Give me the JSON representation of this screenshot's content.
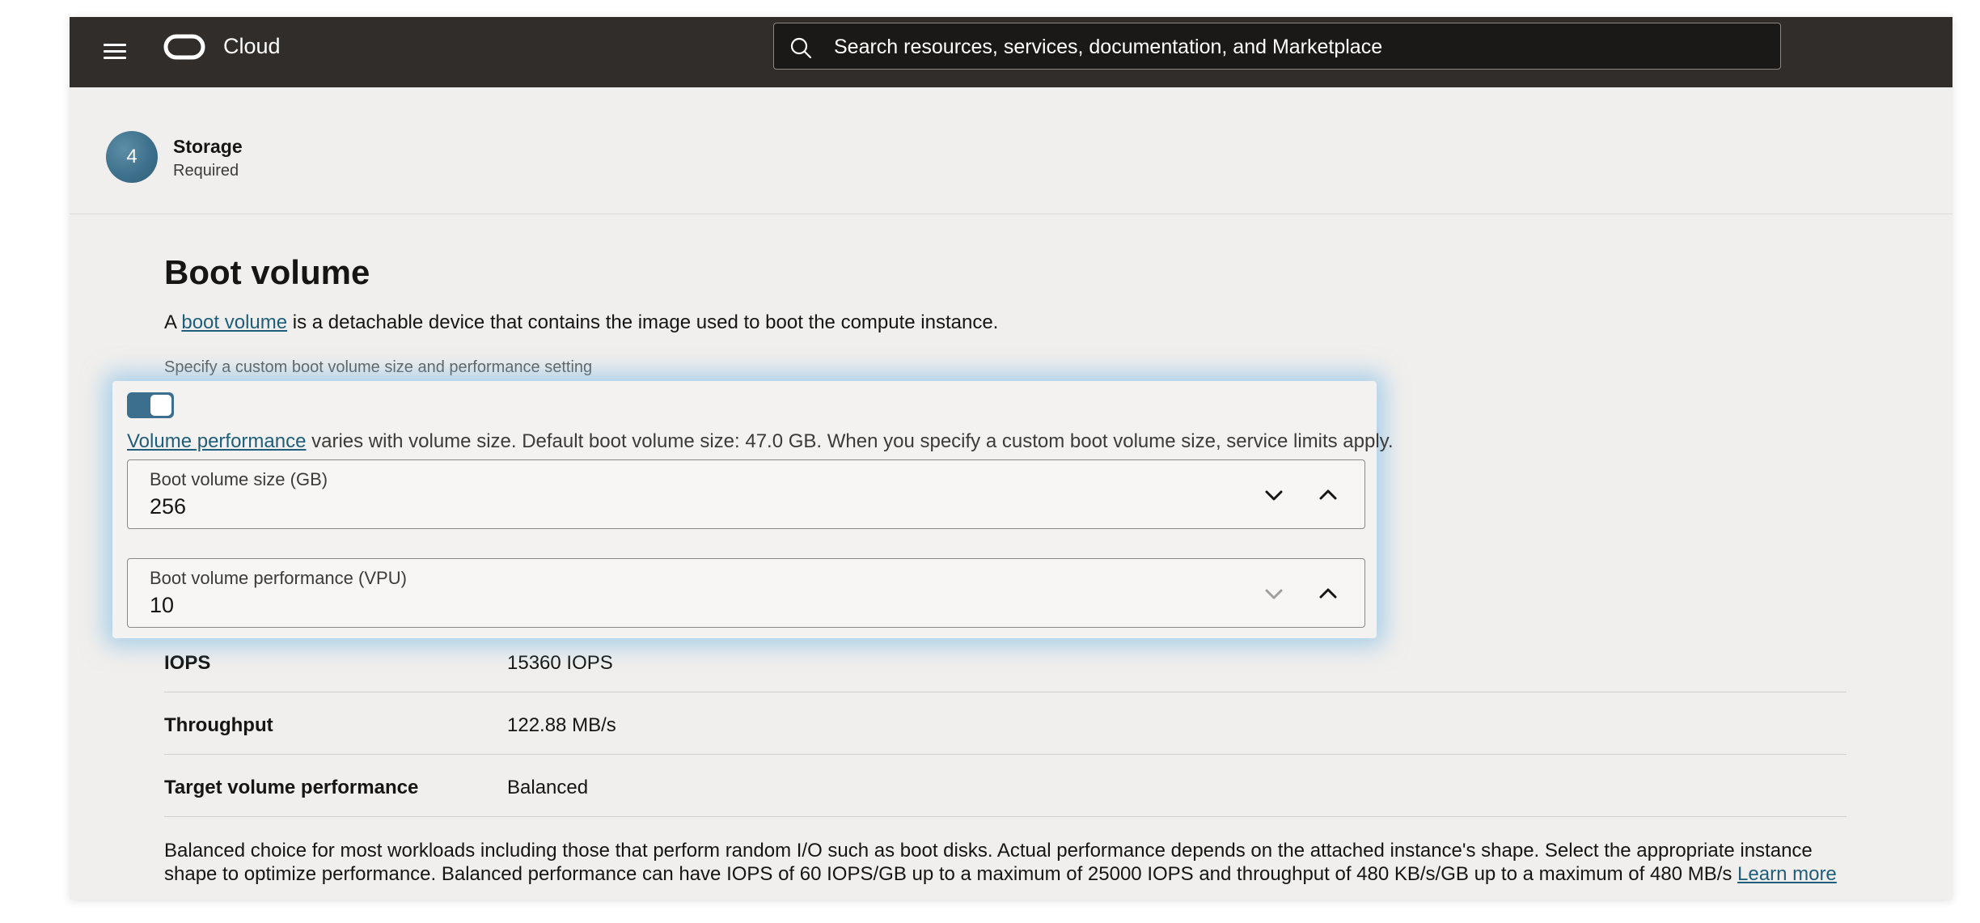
{
  "header": {
    "brand": "Cloud",
    "search": {
      "placeholder": "Search resources, services, documentation, and Marketplace"
    }
  },
  "step": {
    "number": "4",
    "title": "Storage",
    "subtitle": "Required"
  },
  "boot_volume": {
    "title": "Boot volume",
    "desc_prefix": "A ",
    "desc_link": "boot volume",
    "desc_suffix": " is a detachable device that contains the image used to boot the compute instance.",
    "custom_label": "Specify a custom boot volume size and performance setting",
    "toggle_on": true,
    "perf_link": "Volume performance",
    "perf_text": " varies with volume size. Default boot volume size: 47.0 GB. When you specify a custom boot volume size, service limits apply.",
    "size_field": {
      "label": "Boot volume size (GB)",
      "value": "256"
    },
    "vpu_field": {
      "label": "Boot volume performance (VPU)",
      "value": "10"
    }
  },
  "performance": {
    "rows": [
      {
        "key": "IOPS",
        "value": "15360 IOPS"
      },
      {
        "key": "Throughput",
        "value": "122.88 MB/s"
      },
      {
        "key": "Target volume performance",
        "value": "Balanced"
      }
    ],
    "note": "Balanced choice for most workloads including those that perform random I/O such as boot disks. Actual performance depends on the attached instance's shape. Select the appropriate instance shape to optimize performance. Balanced performance can have IOPS of 60 IOPS/GB up to a maximum of 25000 IOPS and throughput of 480 KB/s/GB up to a maximum of 480 MB/s",
    "learn_more": "Learn more"
  },
  "colors": {
    "topbar": "#312d2a",
    "page_bg": "#f1efed",
    "link": "#1f5e7a",
    "toggle": "#3b6f8d",
    "highlight_glow": "#6eb4e6"
  },
  "icons": {
    "menu": "hamburger-menu-icon",
    "logo": "oracle-logo-icon",
    "search": "search-icon",
    "decrement": "chevron-down-icon",
    "increment": "chevron-up-icon"
  }
}
